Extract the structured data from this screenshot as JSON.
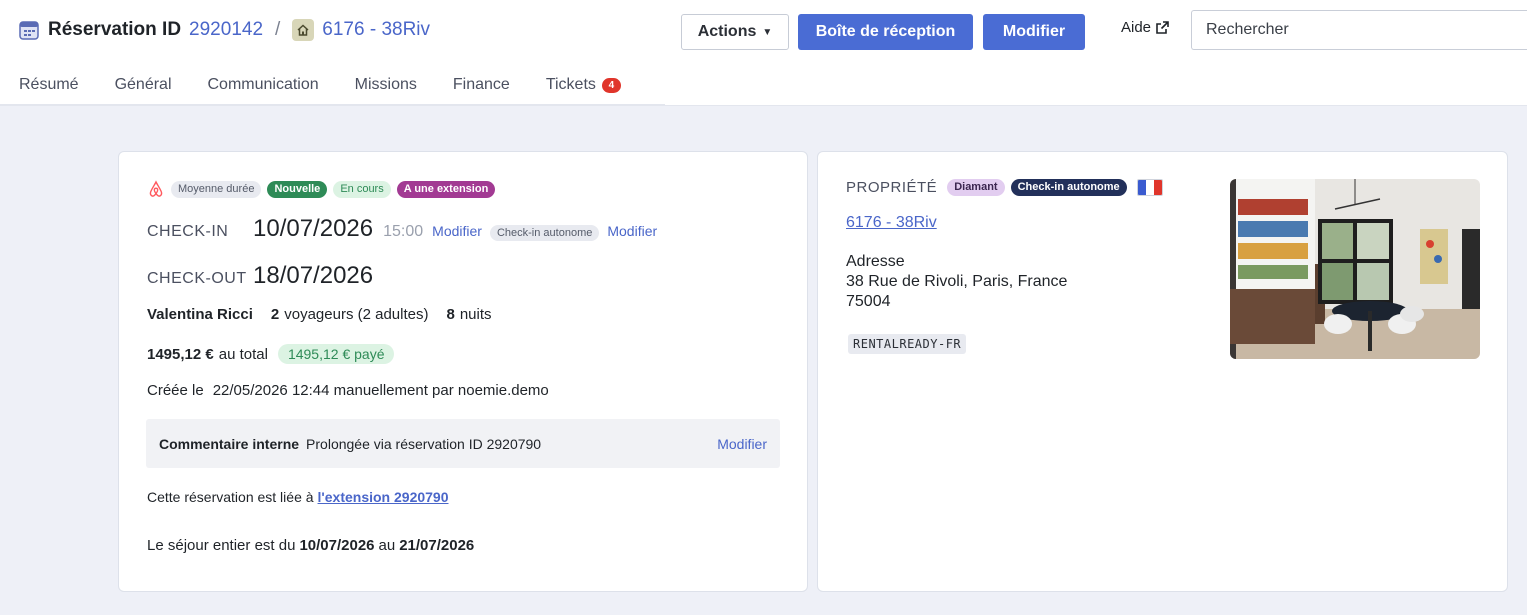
{
  "header": {
    "title_label": "Réservation ID",
    "reservation_id": "2920142",
    "separator": "/",
    "property": "6176 - 38Riv",
    "actions_label": "Actions",
    "inbox_label": "Boîte de réception",
    "edit_label": "Modifier",
    "help_label": "Aide",
    "search_placeholder": "Rechercher"
  },
  "tabs": [
    {
      "label": "Résumé"
    },
    {
      "label": "Général"
    },
    {
      "label": "Communication"
    },
    {
      "label": "Missions"
    },
    {
      "label": "Finance"
    },
    {
      "label": "Tickets",
      "badge": "4"
    }
  ],
  "summary": {
    "badges": [
      "Moyenne durée",
      "Nouvelle",
      "En cours",
      "A une extension"
    ],
    "checkin_label": "CHECK-IN",
    "checkin_date": "10/07/2026",
    "checkin_time": "15:00",
    "checkin_edit": "Modifier",
    "checkin_badge": "Check-in autonome",
    "checkin_badge_edit": "Modifier",
    "checkout_label": "CHECK-OUT",
    "checkout_date": "18/07/2026",
    "guest_name": "Valentina Ricci",
    "guests_count": "2",
    "guests_text": "voyageurs (2 adultes)",
    "nights_count": "8",
    "nights_text": "nuits",
    "total": "1495,12 €",
    "total_suffix": "au total",
    "paid": "1495,12 € payé",
    "created_label": "Créée le",
    "created_value": "22/05/2026 12:44 manuellement par noemie.demo",
    "comment_label": "Commentaire interne",
    "comment_text": "Prolongée via réservation ID 2920790",
    "comment_edit": "Modifier",
    "linked_prefix": "Cette réservation est liée à",
    "linked_link": "l'extension 2920790",
    "stay_prefix": "Le séjour entier est du",
    "stay_start": "10/07/2026",
    "stay_mid": "au",
    "stay_end": "21/07/2026"
  },
  "property": {
    "label": "PROPRIÉTÉ",
    "badges": [
      "Diamant",
      "Check-in autonome"
    ],
    "name": "6176 - 38Riv",
    "address_label": "Adresse",
    "address_line1": "38 Rue de Rivoli, Paris, France",
    "address_line2": "75004",
    "tag": "RENTALREADY-FR"
  },
  "colors": {
    "accent": "#4a6cd4",
    "link": "#4a66c9",
    "success": "#2e8b57",
    "danger": "#e0352b"
  }
}
